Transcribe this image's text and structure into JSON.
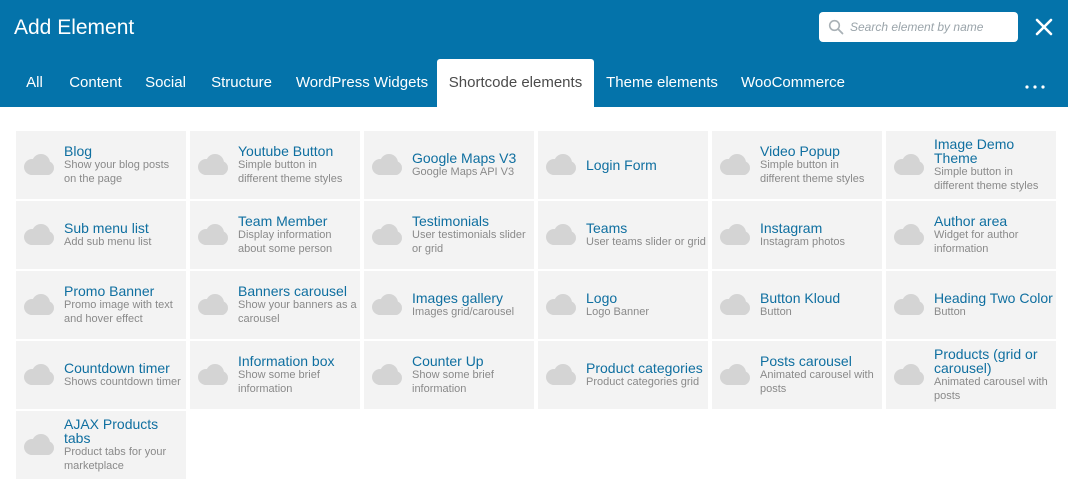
{
  "header": {
    "title": "Add Element",
    "search_placeholder": "Search element by name",
    "search_value": "",
    "search_icon": "search-icon",
    "close_icon": "close-icon",
    "background_color": "#0473aa"
  },
  "tabs": [
    {
      "label": "All",
      "active": false
    },
    {
      "label": "Content",
      "active": false
    },
    {
      "label": "Social",
      "active": false
    },
    {
      "label": "Structure",
      "active": false
    },
    {
      "label": "WordPress Widgets",
      "active": false
    },
    {
      "label": "Shortcode elements",
      "active": true
    },
    {
      "label": "Theme elements",
      "active": false
    },
    {
      "label": "WooCommerce",
      "active": false
    }
  ],
  "more_icon": "more-dots-icon",
  "elements": [
    {
      "name": "Blog",
      "desc": "Show your blog posts on the page"
    },
    {
      "name": "Youtube Button",
      "desc": "Simple button in different theme styles"
    },
    {
      "name": "Google Maps V3",
      "desc": "Google Maps API V3"
    },
    {
      "name": "Login Form",
      "desc": ""
    },
    {
      "name": "Video Popup",
      "desc": "Simple button in different theme styles"
    },
    {
      "name": "Image Demo Theme",
      "desc": "Simple button in different theme styles"
    },
    {
      "name": "Sub menu list",
      "desc": "Add sub menu list"
    },
    {
      "name": "Team Member",
      "desc": "Display information about some person"
    },
    {
      "name": "Testimonials",
      "desc": "User testimonials slider or grid"
    },
    {
      "name": "Teams",
      "desc": "User teams slider or grid"
    },
    {
      "name": "Instagram",
      "desc": "Instagram photos"
    },
    {
      "name": "Author area",
      "desc": "Widget for author information"
    },
    {
      "name": "Promo Banner",
      "desc": "Promo image with text and hover effect"
    },
    {
      "name": "Banners carousel",
      "desc": "Show your banners as a carousel"
    },
    {
      "name": "Images gallery",
      "desc": "Images grid/carousel"
    },
    {
      "name": "Logo",
      "desc": "Logo Banner"
    },
    {
      "name": "Button Kloud",
      "desc": "Button"
    },
    {
      "name": "Heading Two Color",
      "desc": "Button"
    },
    {
      "name": "Countdown timer",
      "desc": "Shows countdown timer"
    },
    {
      "name": "Information box",
      "desc": "Show some brief information"
    },
    {
      "name": "Counter Up",
      "desc": "Show some brief information"
    },
    {
      "name": "Product categories",
      "desc": "Product categories grid"
    },
    {
      "name": "Posts carousel",
      "desc": "Animated carousel with posts"
    },
    {
      "name": "Products (grid or carousel)",
      "desc": "Animated carousel with posts"
    },
    {
      "name": "AJAX Products tabs",
      "desc": "Product tabs for your marketplace"
    }
  ],
  "element_icon": "element-placeholder-icon"
}
